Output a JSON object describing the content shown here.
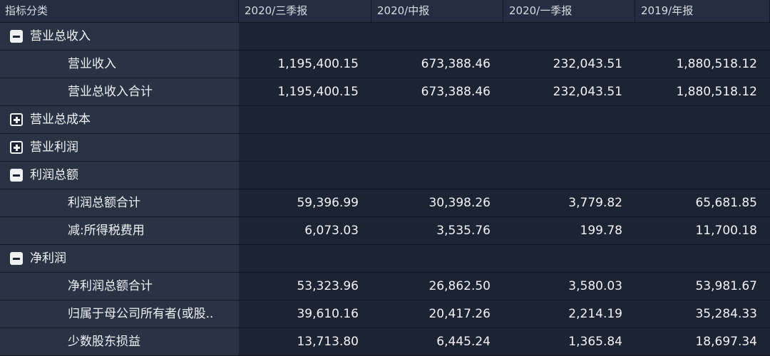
{
  "headers": [
    "指标分类",
    "2020/三季报",
    "2020/中报",
    "2020/一季报",
    "2019/年报"
  ],
  "rows": [
    {
      "type": "group",
      "state": "expanded",
      "label": "营业总收入",
      "values": [
        "",
        "",
        "",
        ""
      ]
    },
    {
      "type": "child",
      "label": "营业收入",
      "values": [
        "1,195,400.15",
        "673,388.46",
        "232,043.51",
        "1,880,518.12"
      ]
    },
    {
      "type": "child",
      "label": "营业总收入合计",
      "values": [
        "1,195,400.15",
        "673,388.46",
        "232,043.51",
        "1,880,518.12"
      ]
    },
    {
      "type": "group",
      "state": "collapsed",
      "label": "营业总成本",
      "values": [
        "",
        "",
        "",
        ""
      ]
    },
    {
      "type": "group",
      "state": "collapsed",
      "label": "营业利润",
      "values": [
        "",
        "",
        "",
        ""
      ]
    },
    {
      "type": "group",
      "state": "expanded",
      "label": "利润总额",
      "values": [
        "",
        "",
        "",
        ""
      ]
    },
    {
      "type": "child",
      "label": "利润总额合计",
      "values": [
        "59,396.99",
        "30,398.26",
        "3,779.82",
        "65,681.85"
      ]
    },
    {
      "type": "child",
      "label": "减:所得税费用",
      "values": [
        "6,073.03",
        "3,535.76",
        "199.78",
        "11,700.18"
      ]
    },
    {
      "type": "group",
      "state": "expanded",
      "label": "净利润",
      "values": [
        "",
        "",
        "",
        ""
      ]
    },
    {
      "type": "child",
      "label": "净利润总额合计",
      "values": [
        "53,323.96",
        "26,862.50",
        "3,580.03",
        "53,981.67"
      ]
    },
    {
      "type": "child",
      "label": "归属于母公司所有者(或股..",
      "values": [
        "39,610.16",
        "20,417.26",
        "2,214.19",
        "35,284.33"
      ]
    },
    {
      "type": "child",
      "label": "少数股东损益",
      "values": [
        "13,713.80",
        "6,445.24",
        "1,365.84",
        "18,697.34"
      ]
    }
  ],
  "colors": {
    "background": "#1a2232",
    "label_column": "#2a3344",
    "header": "#252e40"
  },
  "icons": {
    "expanded": "minus-square-icon",
    "collapsed": "plus-square-icon"
  }
}
